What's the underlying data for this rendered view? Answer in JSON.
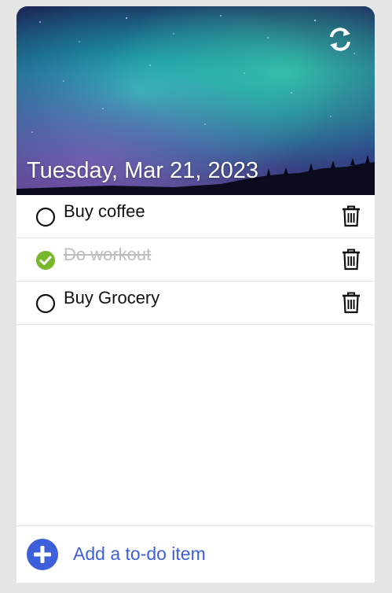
{
  "header": {
    "date": "Tuesday, Mar 21, 2023",
    "refresh_icon": "refresh-icon"
  },
  "todos": [
    {
      "label": "Buy coffee",
      "done": false
    },
    {
      "label": "Do workout",
      "done": true
    },
    {
      "label": "Buy Grocery",
      "done": false
    }
  ],
  "footer": {
    "add_label": "Add a to-do item",
    "add_icon": "plus-circle-icon"
  },
  "colors": {
    "accent": "#3d5fd9",
    "done_check": "#77b82a",
    "background": "#e6e6e6"
  }
}
